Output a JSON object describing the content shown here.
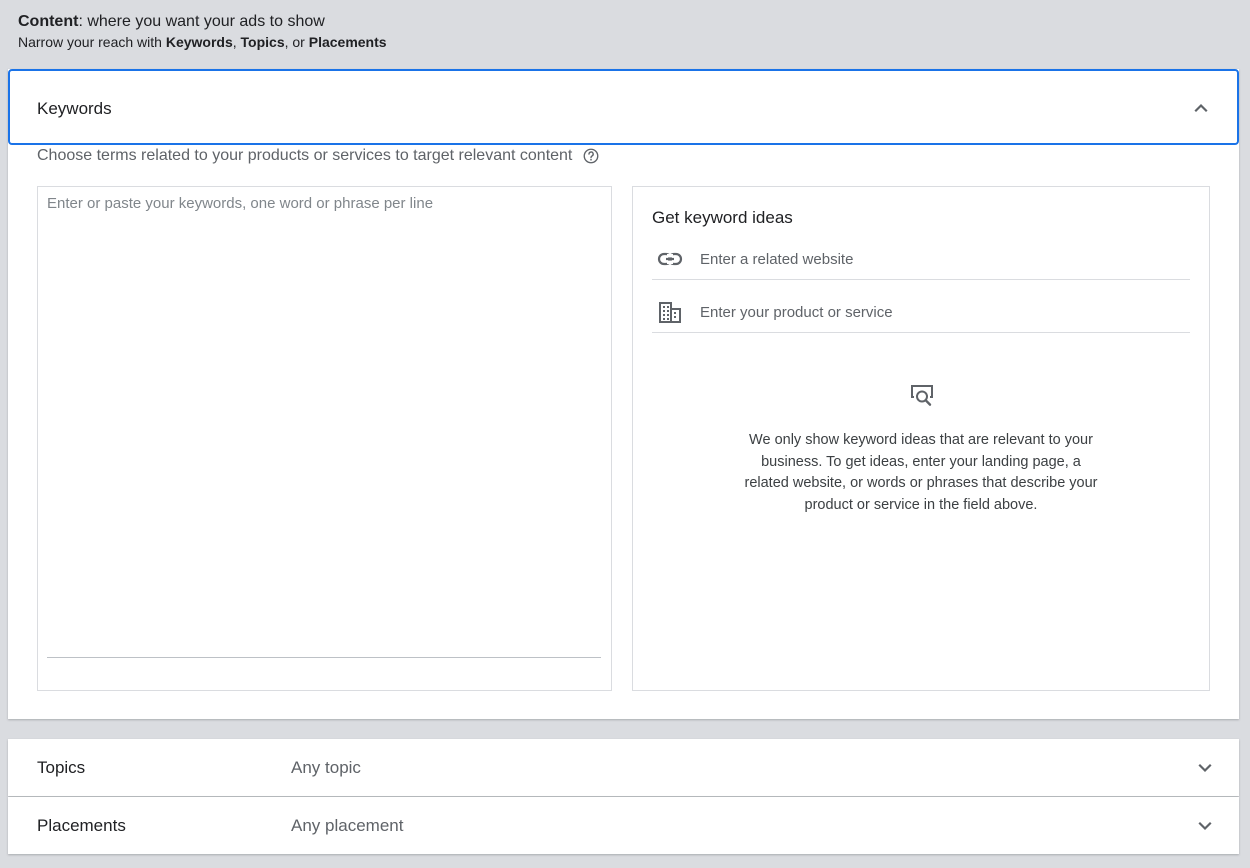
{
  "header": {
    "title_bold": "Content",
    "title_rest": ": where you want your ads to show",
    "subtitle_prefix": "Narrow your reach with ",
    "subtitle_kw": "Keywords",
    "subtitle_sep1": ", ",
    "subtitle_topics": "Topics",
    "subtitle_sep2": ", or ",
    "subtitle_placements": "Placements"
  },
  "keywords_panel": {
    "label": "Keywords",
    "description": "Choose terms related to your products or services to target relevant content",
    "textarea_placeholder": "Enter or paste your keywords, one word or phrase per line",
    "textarea_value": ""
  },
  "ideas": {
    "title": "Get keyword ideas",
    "website_placeholder": "Enter a related website",
    "website_value": "",
    "product_placeholder": "Enter your product or service",
    "product_value": "",
    "empty_message": "We only show keyword ideas that are relevant to your business. To get ideas, enter your landing page, a related website, or words or phrases that describe your product or service in the field above."
  },
  "rows": [
    {
      "name": "Topics",
      "value": "Any topic"
    },
    {
      "name": "Placements",
      "value": "Any placement"
    }
  ],
  "colors": {
    "accent": "#1a73e8",
    "background": "#dadce0",
    "text_primary": "#202124",
    "text_secondary": "#5f6368"
  },
  "icons": {
    "collapse": "chevron-up-icon",
    "expand": "chevron-down-icon",
    "help": "help-circle-icon",
    "website": "link-icon",
    "product": "business-icon",
    "empty_state": "search-document-icon"
  }
}
